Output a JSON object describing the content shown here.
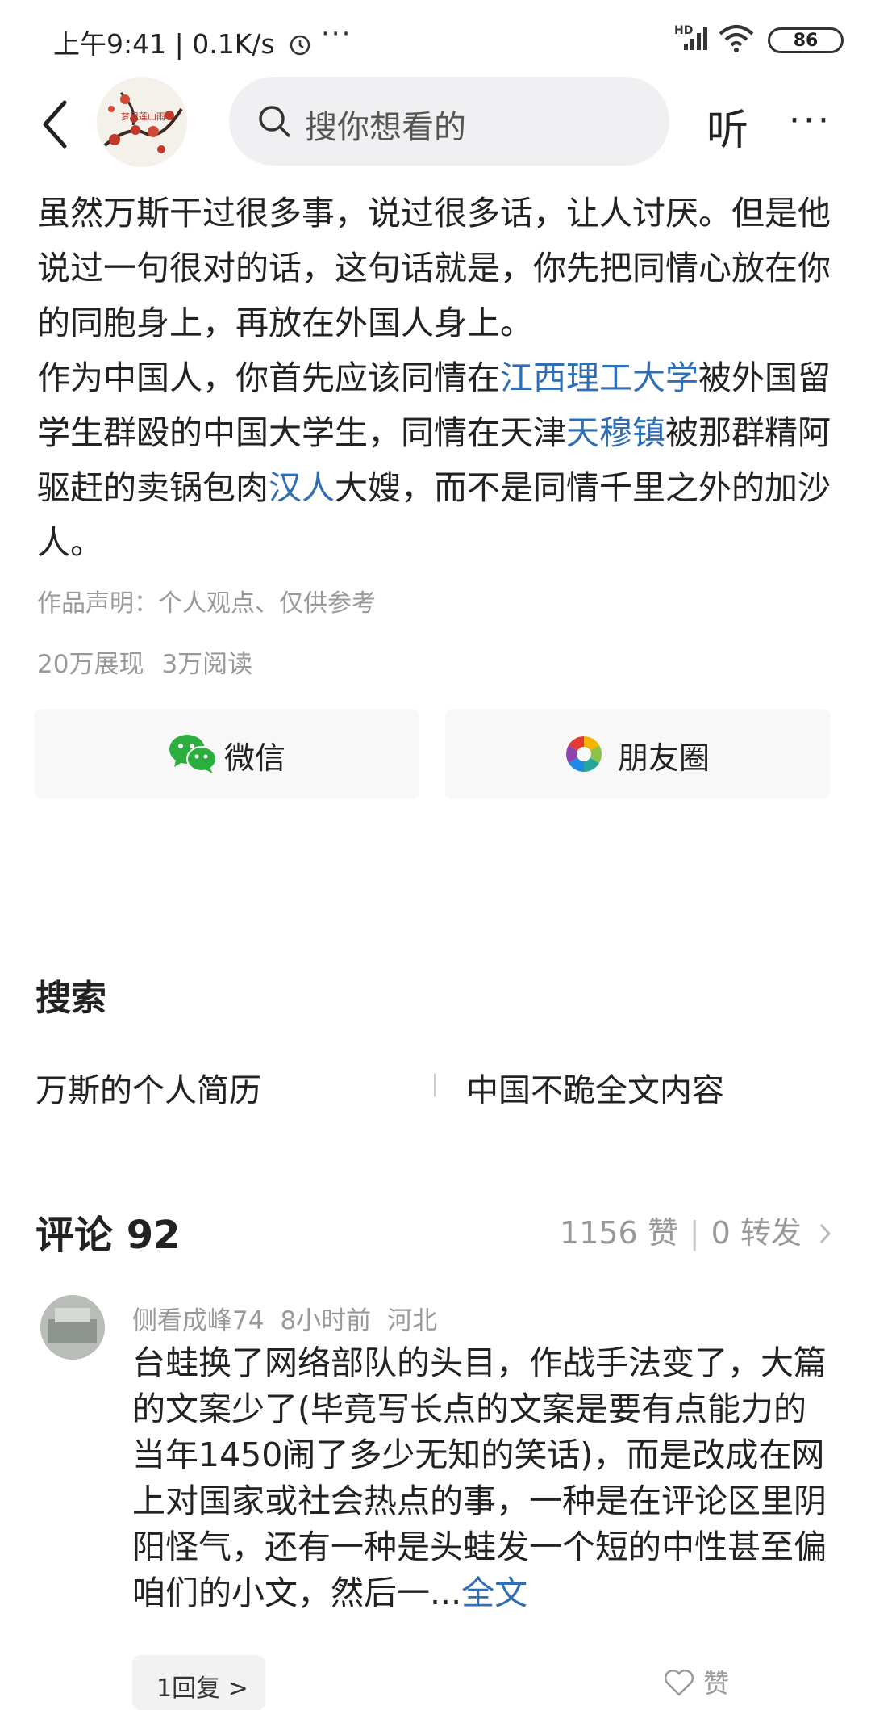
{
  "status_bar": {
    "time": "上午9:41",
    "speed": "0.1K/s",
    "more": "···",
    "network_badge": "HD",
    "battery": "86"
  },
  "nav": {
    "avatar_caption": "梦里莲山雨",
    "search_placeholder": "搜你想看的",
    "listen_label": "听"
  },
  "article": {
    "paragraph1": "虽然万斯干过很多事，说过很多话，让人讨厌。但是他说过一句很对的话，这句话就是，你先把同情心放在你的同胞身上，再放在外国人身上。",
    "p2_part1": "作为中国人，你首先应该同情在",
    "p2_link1": "江西理工大学",
    "p2_part2": "被外国留学生群殴的中国大学生，同情在天津",
    "p2_link2": "天穆镇",
    "p2_part3": "被那群精阿驱赶的卖锅包肉",
    "p2_link3": "汉人",
    "p2_part4": "大嫂，而不是同情千里之外的加沙人。",
    "disclaimer": "作品声明：个人观点、仅供参考",
    "impressions": "20万展现",
    "reads": "3万阅读"
  },
  "share": {
    "wechat_label": "微信",
    "moments_label": "朋友圈"
  },
  "search_section": {
    "title": "搜索",
    "suggestions": [
      "万斯的个人简历",
      "中国不跪全文内容"
    ]
  },
  "comments": {
    "header": "评论 92",
    "likes": "1156 赞",
    "forwards": "0 转发",
    "items": [
      {
        "user": "侧看成峰74",
        "time": "8小时前",
        "location": "河北",
        "text": "台蛙换了网络部队的头目，作战手法变了，大篇的文案少了(毕竟写长点的文案是要有点能力的当年1450闹了多少无知的笑话)，而是改成在网上对国家或社会热点的事，一种是在评论区里阴阳怪气，还有一种是头蛙发一个短的中性甚至偏咱们的小文，然后一...",
        "fulltext_label": "全文",
        "reply_label": "1回复 >",
        "like_label": "赞"
      }
    ]
  },
  "colors": {
    "link": "#2e6eb5",
    "muted": "#999999",
    "text": "#222222"
  }
}
